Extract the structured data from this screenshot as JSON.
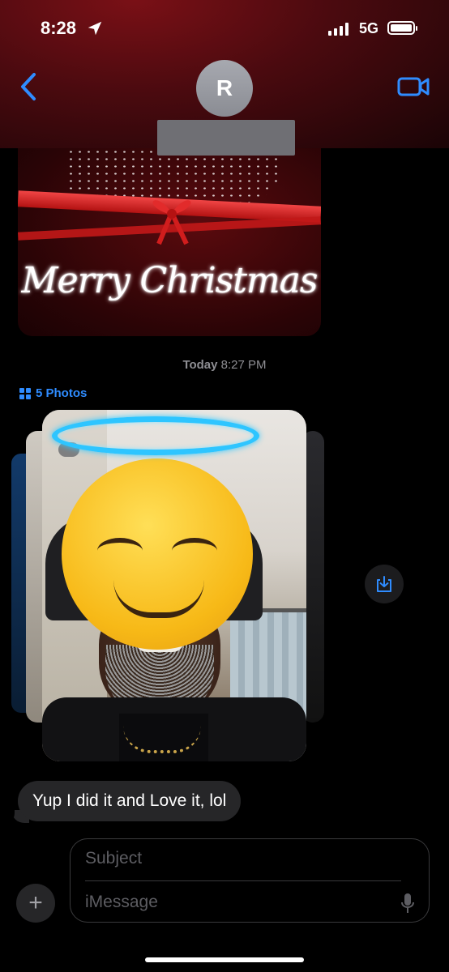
{
  "status_bar": {
    "time": "8:28",
    "network": "5G"
  },
  "header": {
    "contact_initial": "R"
  },
  "messages": {
    "image_text": "Merry Christmas",
    "timestamp_day": "Today",
    "timestamp_time": "8:27 PM",
    "photos_label": "5 Photos",
    "received_text": "Yup I did it and Love it, lol"
  },
  "composer": {
    "subject_placeholder": "Subject",
    "message_placeholder": "iMessage"
  },
  "colors": {
    "accent": "#2f8cff",
    "bubble_gray": "#262628",
    "halo": "#2ec5ff"
  }
}
